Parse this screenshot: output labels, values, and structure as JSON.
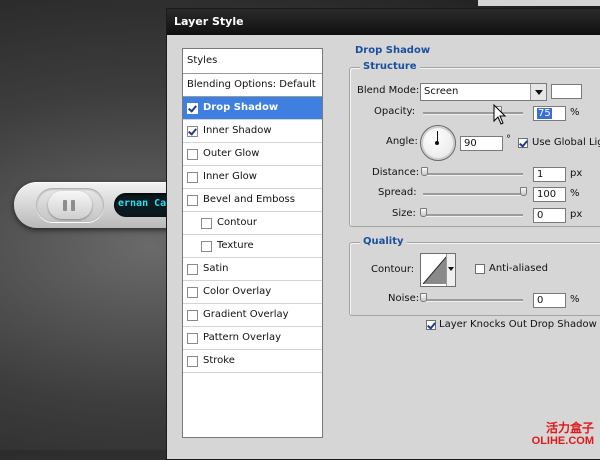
{
  "player": {
    "track_text": "ernan Catt"
  },
  "dialog": {
    "title": "Layer Style",
    "styles_list": [
      {
        "label": "Styles",
        "type": "header"
      },
      {
        "label": "Blending Options: Default",
        "type": "blending"
      },
      {
        "label": "Drop Shadow",
        "checked": true,
        "active": true
      },
      {
        "label": "Inner Shadow",
        "checked": true
      },
      {
        "label": "Outer Glow",
        "checked": false
      },
      {
        "label": "Inner Glow",
        "checked": false
      },
      {
        "label": "Bevel and Emboss",
        "checked": false
      },
      {
        "label": "Contour",
        "checked": false,
        "sub": true
      },
      {
        "label": "Texture",
        "checked": false,
        "sub": true
      },
      {
        "label": "Satin",
        "checked": false
      },
      {
        "label": "Color Overlay",
        "checked": false
      },
      {
        "label": "Gradient Overlay",
        "checked": false
      },
      {
        "label": "Pattern Overlay",
        "checked": false
      },
      {
        "label": "Stroke",
        "checked": false
      }
    ],
    "drop_shadow": {
      "title": "Drop Shadow",
      "structure": {
        "title": "Structure",
        "blend_mode_label": "Blend Mode:",
        "blend_mode_value": "Screen",
        "swatch_color": "#ffffff",
        "opacity_label": "Opacity:",
        "opacity_value": "75",
        "opacity_level": 75,
        "percent_unit": "%",
        "angle_label": "Angle:",
        "angle_value": "90",
        "degree_unit": "°",
        "use_global_light_label": "Use Global Ligh",
        "use_global_light_checked": true,
        "distance_label": "Distance:",
        "distance_value": "1",
        "distance_level": 1,
        "px_unit": "px",
        "spread_label": "Spread:",
        "spread_value": "100",
        "spread_level": 100,
        "size_label": "Size:",
        "size_value": "0",
        "size_level": 0
      },
      "quality": {
        "title": "Quality",
        "contour_label": "Contour:",
        "anti_aliased_label": "Anti-aliased",
        "anti_aliased_checked": false,
        "noise_label": "Noise:",
        "noise_value": "0",
        "noise_level": 0,
        "percent_unit": "%"
      },
      "knockout_label": "Layer Knocks Out Drop Shadow",
      "knockout_checked": true
    }
  },
  "colors": {
    "section_title": "#1a4f9f",
    "selection": "#3f7fe0",
    "player_screen_text": "#30dcf4"
  },
  "watermark": {
    "cn": "活力盒子",
    "en": "OLIHE.COM"
  }
}
